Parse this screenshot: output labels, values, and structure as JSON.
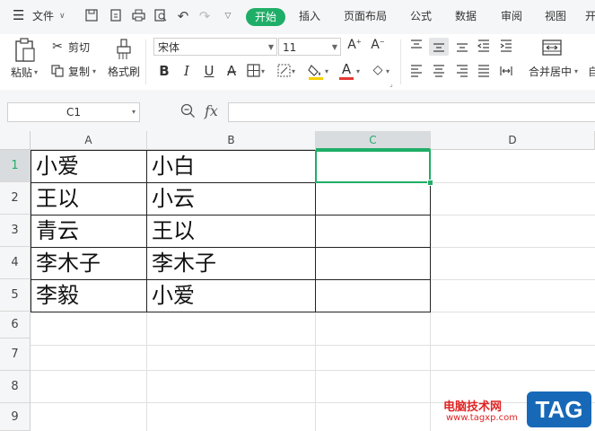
{
  "menu": {
    "file_label": "文件",
    "menu_icon": "hamburger-icon"
  },
  "tabs": [
    {
      "label": "开始",
      "active": true
    },
    {
      "label": "插入"
    },
    {
      "label": "页面布局"
    },
    {
      "label": "公式"
    },
    {
      "label": "数据"
    },
    {
      "label": "审阅"
    },
    {
      "label": "视图"
    },
    {
      "label": "开"
    }
  ],
  "ribbon": {
    "paste": "粘贴",
    "cut": "剪切",
    "copy": "复制",
    "format_painter": "格式刷",
    "font_name": "宋体",
    "font_size": "11",
    "bold": "B",
    "italic": "I",
    "underline": "U",
    "font_color_letter": "A",
    "merge_center": "合并居中",
    "accent_color": "#1fae67",
    "font_color": "#e53935",
    "fill_color": "#f5d000"
  },
  "formula_bar": {
    "name_box": "C1",
    "fx": "fx",
    "formula": ""
  },
  "sheet": {
    "columns": [
      "A",
      "B",
      "C",
      "D"
    ],
    "rows": [
      "1",
      "2",
      "3",
      "4",
      "5",
      "6",
      "7",
      "8",
      "9"
    ],
    "selected_cell": "C1",
    "data": [
      [
        "小爱",
        "小白"
      ],
      [
        "王以",
        "小云"
      ],
      [
        "青云",
        "王以"
      ],
      [
        "李木子",
        "李木子"
      ],
      [
        "李毅",
        "小爱"
      ]
    ]
  },
  "watermark": {
    "site": "电脑技术网",
    "url": "www.tagxp.com",
    "badge": "TAG"
  }
}
